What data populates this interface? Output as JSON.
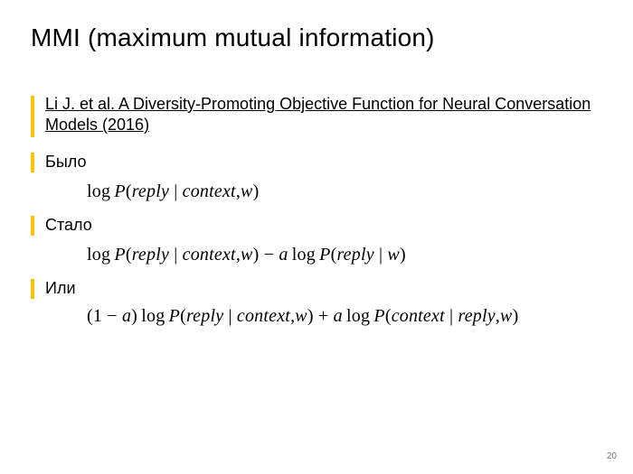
{
  "title": "MMI (maximum mutual information)",
  "reference": "Li J. et al. A Diversity-Promoting Objective Function for Neural Conversation Models (2016)",
  "labels": {
    "was": "Было",
    "became": "Стало",
    "or": "Или"
  },
  "equations": {
    "eq1_log": "log",
    "eq1_P": "P",
    "eq1_lp": "(",
    "eq1_reply": "reply",
    "eq1_bar": " | ",
    "eq1_context": "context",
    "eq1_comma": ",",
    "eq1_w": "w",
    "eq1_rp": ")",
    "eq2_minus": " − ",
    "eq2_a": "a",
    "eq3_one_minus_a_l": "(1 − ",
    "eq3_one_minus_a_r": ")",
    "eq3_plus": " + "
  },
  "page_number": "20"
}
